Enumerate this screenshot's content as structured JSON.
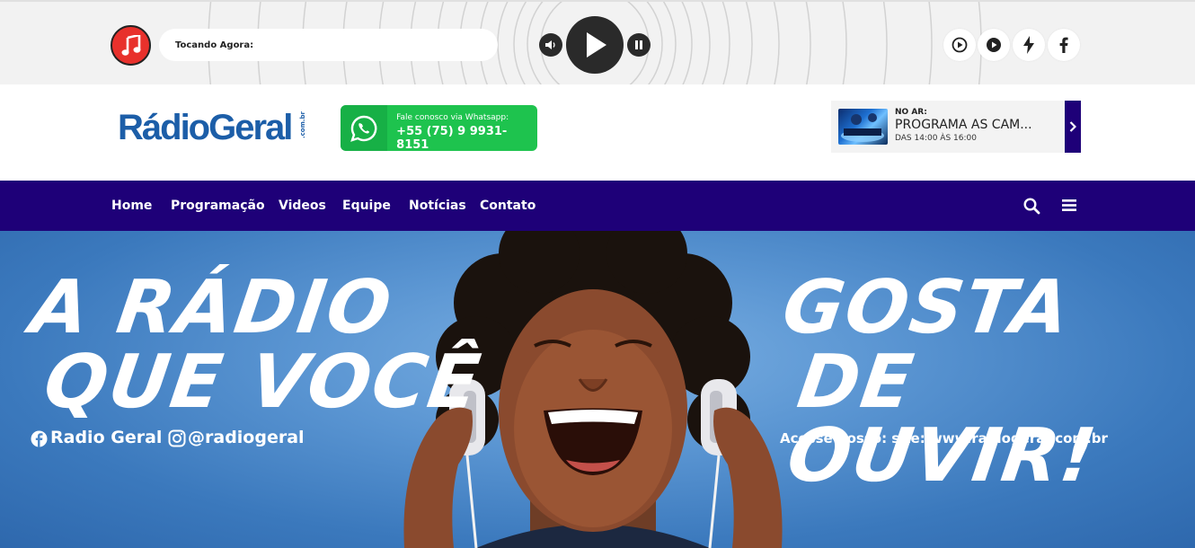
{
  "player": {
    "now_playing_label": "Tocando Agora:",
    "icons": [
      "music-icon",
      "volume-icon",
      "play-icon",
      "pause-icon",
      "play-circle-icon",
      "play-filled-icon",
      "lightning-icon",
      "facebook-icon"
    ]
  },
  "header": {
    "logo_text": "RádioGeral",
    "logo_suffix": ".com.br",
    "whatsapp_label": "Fale conosco via Whatsapp:",
    "whatsapp_number": "+55 (75) 9 9931-8151",
    "onair_label": "NO AR:",
    "onair_title": "PROGRAMA AS CAM...",
    "onair_time": "DAS 14:00 ÀS 16:00"
  },
  "nav": {
    "items": [
      "Home",
      "Programação",
      "Videos",
      "Equipe",
      "Notícias",
      "Contato"
    ]
  },
  "hero": {
    "line1": "A RÁDIO",
    "line2": "QUE VOCÊ",
    "line3": "GOSTA",
    "line4": "DE OUVIR!",
    "facebook_handle": "Radio Geral",
    "instagram_handle": "@radiogeral",
    "site_text": "Acesse nosso: site: www.radiogeral.com.br"
  },
  "colors": {
    "nav_bg": "#1e0078",
    "whatsapp": "#1ec34e",
    "music_red": "#e8312c",
    "hero_blue": "#4a86c8"
  }
}
